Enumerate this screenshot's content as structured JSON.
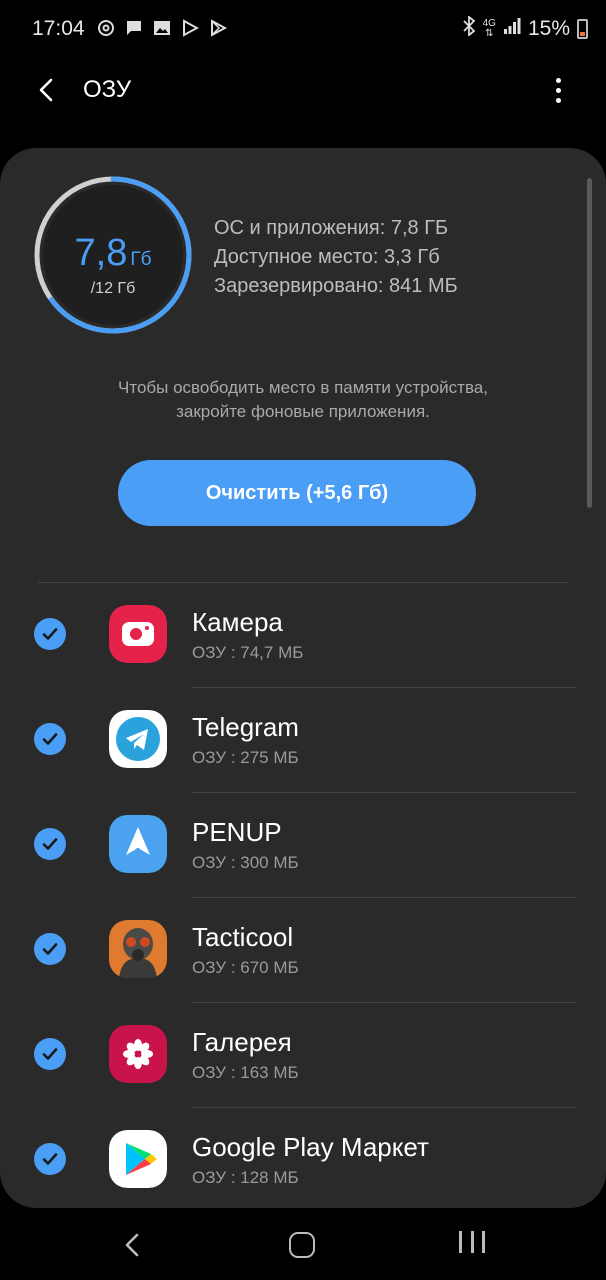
{
  "status_bar": {
    "time": "17:04",
    "battery_percent": "15%",
    "network": "4G",
    "icons": [
      "threads-icon",
      "message-icon",
      "gallery-icon",
      "play-icon",
      "play-store-icon",
      "bluetooth-icon",
      "signal-icon",
      "battery-icon"
    ]
  },
  "app_bar": {
    "title": "ОЗУ"
  },
  "ram": {
    "used_value": "7,8",
    "used_unit": "Гб",
    "total": "/12 Гб",
    "used_fraction": 0.65,
    "stats": [
      "ОС и приложения: 7,8 ГБ",
      "Доступное место: 3,3 Гб",
      "Зарезервировано: 841 МБ"
    ],
    "hint_line1": "Чтобы освободить место в памяти устройства,",
    "hint_line2": "закройте фоновые приложения.",
    "clear_button": "Очистить (+5,6 Гб)"
  },
  "apps": [
    {
      "name": "Камера",
      "ram": "ОЗУ : 74,7 МБ",
      "icon": "camera-icon",
      "checked": true
    },
    {
      "name": "Telegram",
      "ram": "ОЗУ : 275 МБ",
      "icon": "telegram-icon",
      "checked": true
    },
    {
      "name": "PENUP",
      "ram": "ОЗУ : 300 МБ",
      "icon": "penup-icon",
      "checked": true
    },
    {
      "name": "Tacticool",
      "ram": "ОЗУ : 670 МБ",
      "icon": "tacticool-icon",
      "checked": true
    },
    {
      "name": "Галерея",
      "ram": "ОЗУ : 163 МБ",
      "icon": "gallery-app-icon",
      "checked": true
    },
    {
      "name": "Google Play Маркет",
      "ram": "ОЗУ : 128 МБ",
      "icon": "google-play-icon",
      "checked": true
    }
  ],
  "colors": {
    "accent": "#4a9ef5",
    "background": "#000000",
    "card": "#2a2a2a"
  }
}
